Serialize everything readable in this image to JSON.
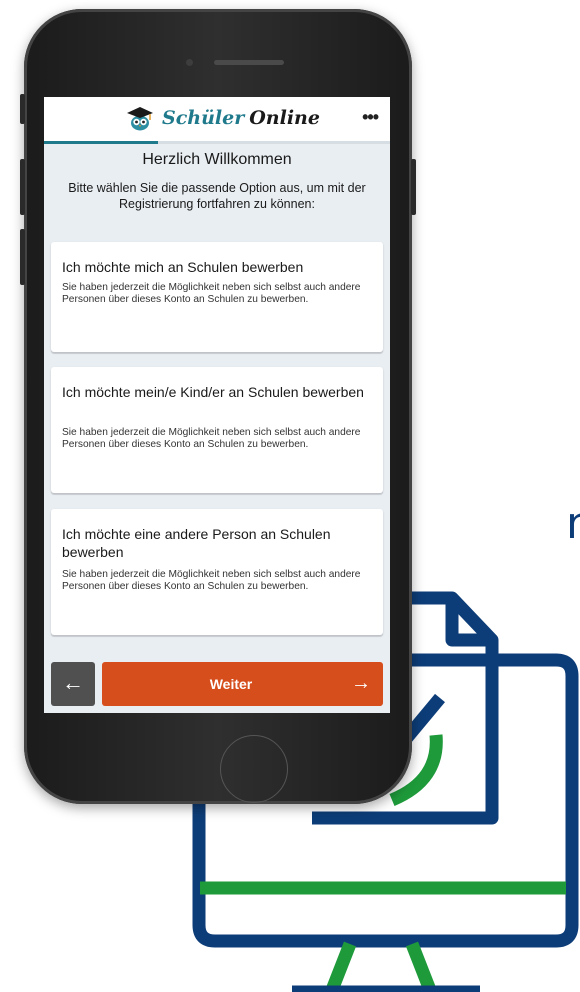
{
  "app": {
    "brand_part1": "Schüler",
    "brand_part2": "Online",
    "menu_icon": "•••",
    "progress": 0.33
  },
  "page": {
    "title": "Herzlich Willkommen",
    "subtitle": "Bitte wählen Sie die passende Option aus, um mit der Registrierung fortfahren zu können:"
  },
  "options": [
    {
      "title": "Ich möchte mich an Schulen bewerben",
      "description": "Sie haben jederzeit die Möglichkeit neben sich selbst auch andere Personen über dieses Konto an Schulen zu bewerben."
    },
    {
      "title": "Ich möchte mein/e Kind/er an Schulen bewerben",
      "description": "Sie haben jederzeit die Möglichkeit neben sich selbst auch andere Personen über dieses Konto an Schulen zu bewerben."
    },
    {
      "title": "Ich möchte eine andere Person an Schulen bewerben",
      "description": "Sie haben jederzeit die Möglichkeit neben sich selbst auch andere Personen über dieses Konto an Schulen zu bewerben."
    }
  ],
  "footer": {
    "back_icon": "←",
    "next_label": "Weiter",
    "next_icon": "→"
  },
  "background": {
    "stray_letter": "n"
  },
  "colors": {
    "accent_teal": "#1f7a8c",
    "primary_orange": "#d64e1c",
    "back_button": "#505050",
    "illustration_blue": "#0d3d78",
    "illustration_green": "#1e9a3a"
  }
}
